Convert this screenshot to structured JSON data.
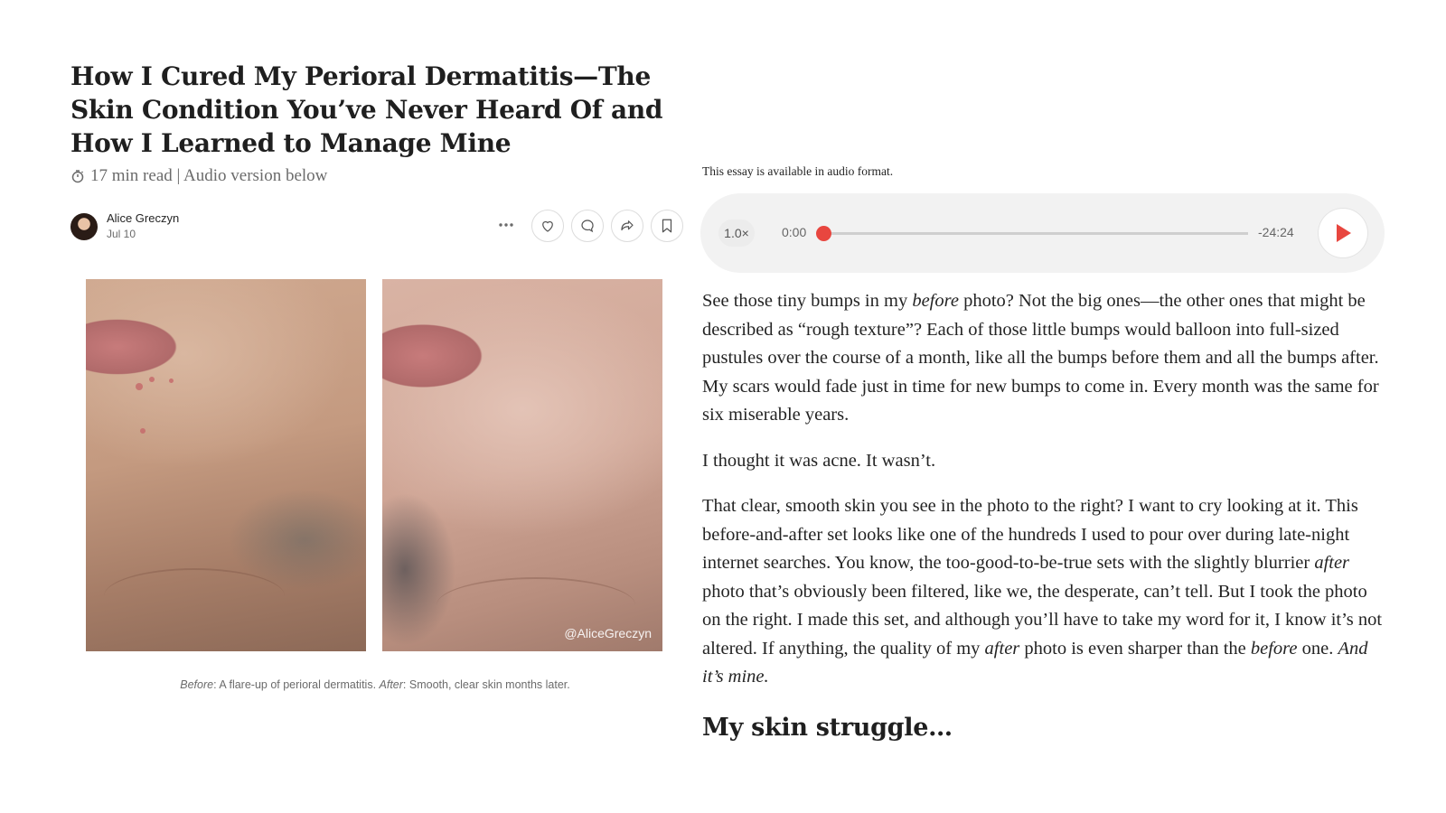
{
  "article": {
    "title": "How I Cured My Perioral Dermatitis—The Skin Condition You’ve Never Heard Of and How I Learned to Manage Mine",
    "meta": "17 min read | Audio version below",
    "meta_icon": "stopwatch-icon"
  },
  "author": {
    "name": "Alice Greczyn",
    "date": "Jul 10"
  },
  "actions": {
    "icons": [
      "more-icon",
      "heart-icon",
      "comment-icon",
      "share-icon",
      "bookmark-icon"
    ]
  },
  "images": {
    "watermark": "@AliceGreczyn"
  },
  "caption": {
    "before_label": "Before",
    "before_text": ": A flare-up of perioral dermatitis. ",
    "after_label": "After",
    "after_text": ": Smooth, clear skin months later."
  },
  "audio": {
    "note": "This essay is available in audio format.",
    "speed": "1.0×",
    "current_time": "0:00",
    "remaining_time": "-24:24",
    "progress": 0,
    "accent_color": "#e8463f"
  },
  "body": {
    "p1": [
      "See those tiny bumps in my ",
      "before",
      " photo? Not the big ones—the other ones that might be described as “rough texture”? Each of those little bumps would balloon into full-sized pustules over the course of a month, like all the bumps before them and all the bumps after. My scars would fade just in time for new bumps to come in. Every month was the same for six miserable years."
    ],
    "p2": "I thought it was acne. It wasn’t.",
    "p3": [
      "That clear, smooth skin you see in the photo to the right? I want to cry looking at it. This before-and-after set looks like one of the hundreds I used to pour over during late-night internet searches. You know, the too-good-to-be-true sets with the slightly blurrier ",
      "after",
      " photo that’s obviously been filtered, like we, the desperate, can’t tell. But I took the photo on the right. I made this set, and although you’ll have to take my word for it, I know it’s not altered. If anything, the quality of my ",
      "after",
      " photo is even sharper than the ",
      "before",
      " one. ",
      "And it’s mine."
    ],
    "subhead": "My skin struggle…"
  }
}
